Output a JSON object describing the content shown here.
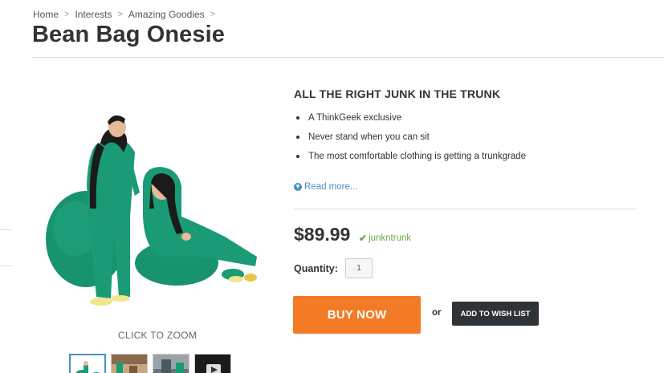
{
  "breadcrumb": {
    "items": [
      "Home",
      "Interests",
      "Amazing Goodies"
    ],
    "separator": ">"
  },
  "product": {
    "title": "Bean Bag Onesie",
    "headline": "ALL THE RIGHT JUNK IN THE TRUNK",
    "features": [
      "A ThinkGeek exclusive",
      "Never stand when you can sit",
      "The most comfortable clothing is getting a trunkgrade"
    ],
    "read_more": "Read more...",
    "price": "$89.99",
    "promo_code": "junkntrunk",
    "quantity_label": "Quantity:",
    "quantity_value": "1",
    "buy_label": "BUY NOW",
    "or_label": "or",
    "wishlist_label": "ADD TO WISH LIST"
  },
  "gallery": {
    "zoom_label": "CLICK TO ZOOM",
    "main_image_icon": "product-photo-bean-bag-onesie",
    "thumbnails": [
      "thumb-1",
      "thumb-2",
      "thumb-3",
      "thumb-video"
    ]
  },
  "colors": {
    "buy_button": "#f47b25",
    "wishlist_button": "#2e3338",
    "link": "#4a90c2",
    "promo": "#6aa84f",
    "onesie_green": "#1a9b75"
  }
}
